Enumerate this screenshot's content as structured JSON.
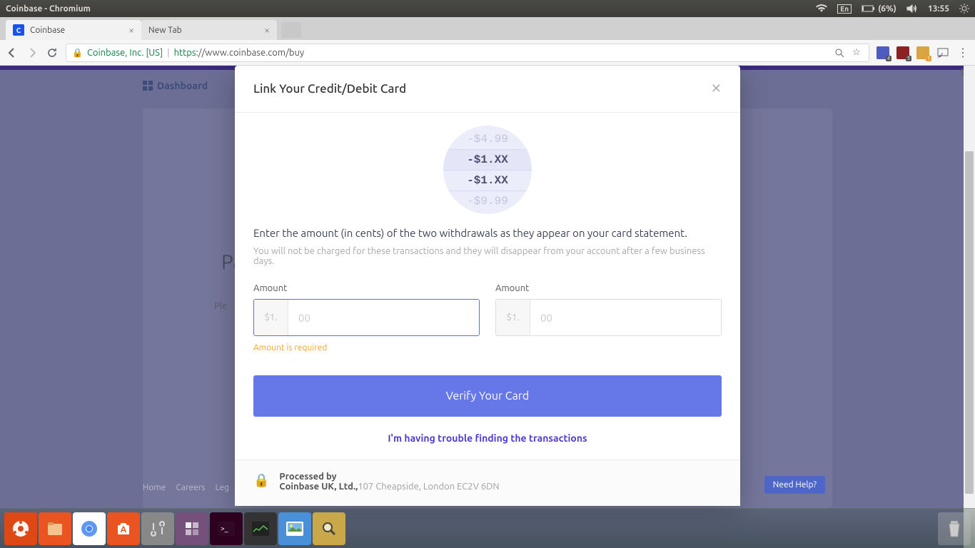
{
  "os": {
    "window_title": "Coinbase - Chromium",
    "indicators": {
      "lang": "En",
      "battery": "(6%)",
      "time": "13:55"
    }
  },
  "browser": {
    "tabs": [
      {
        "title": "Coinbase",
        "active": true
      },
      {
        "title": "New Tab",
        "active": false
      }
    ],
    "ev_cert": "Coinbase, Inc. [US]",
    "url_scheme": "https",
    "url_rest": "://www.coinbase.com/buy"
  },
  "background": {
    "nav_item": "Dashboard",
    "heading_partial": "Pay",
    "sub_partial": "Ple",
    "footer_links": [
      "Home",
      "Careers",
      "Leg"
    ],
    "need_help": "Need Help?"
  },
  "modal": {
    "title": "Link Your Credit/Debit Card",
    "wheel": {
      "r1": "-$4.99",
      "r2": "-$1.XX",
      "r3": "-$1.XX",
      "r4": "-$9.99"
    },
    "instruction": "Enter the amount (in cents) of the two withdrawals as they appear on your card statement.",
    "sub_instruction": "You will not be charged for these transactions and they will disappear from your account after a few business days.",
    "amount1": {
      "label": "Amount",
      "prefix": "$1.",
      "placeholder": "00",
      "error": "Amount is required"
    },
    "amount2": {
      "label": "Amount",
      "prefix": "$1.",
      "placeholder": "00"
    },
    "verify_button": "Verify Your Card",
    "trouble_link": "I'm having trouble finding the transactions",
    "footer": {
      "processed_by": "Processed by",
      "company": "Coinbase UK, Ltd.,",
      "address": "107 Cheapside, London EC2V 6DN"
    }
  }
}
